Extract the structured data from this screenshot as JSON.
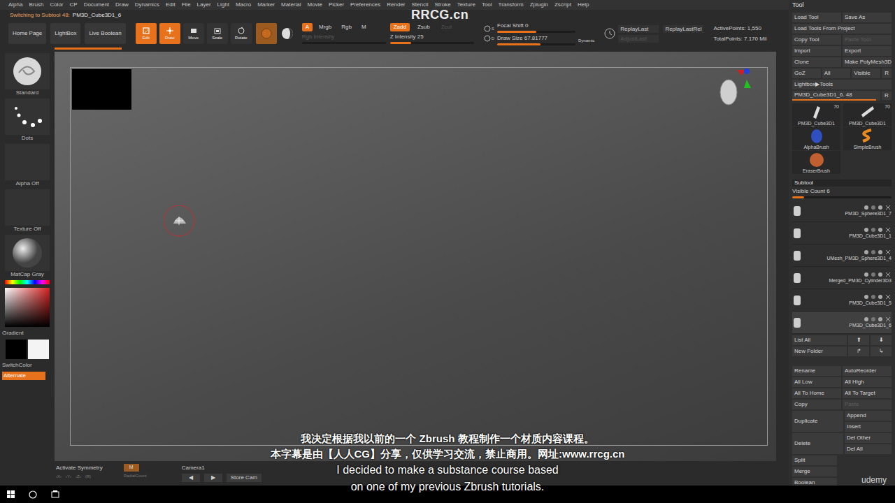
{
  "watermark": "RRCG.cn",
  "menu": [
    "Alpha",
    "Brush",
    "Color",
    "CP",
    "Document",
    "Draw",
    "Dynamics",
    "Edit",
    "File",
    "Layer",
    "Light",
    "Macro",
    "Marker",
    "Material",
    "Movie",
    "Picker",
    "Preferences",
    "Render",
    "Stencil",
    "Stroke",
    "Texture",
    "Tool",
    "Transform",
    "Zplugin",
    "Zscript",
    "Help"
  ],
  "status": {
    "label": "Switching to Subtool 48:",
    "value": "PM3D_Cube3D1_6"
  },
  "toolbar": {
    "nav": [
      "Home Page",
      "LightBox",
      "Live Boolean"
    ],
    "modes": [
      {
        "label": "Edit",
        "selected": true
      },
      {
        "label": "Draw",
        "selected": true
      },
      {
        "label": "Move",
        "selected": false
      },
      {
        "label": "Scale",
        "selected": false
      },
      {
        "label": "Rotate",
        "selected": false
      }
    ],
    "channels": [
      {
        "label": "A",
        "selected": true
      },
      {
        "label": "Mrgb",
        "selected": false
      },
      {
        "label": "Rgb",
        "selected": false
      },
      {
        "label": "M",
        "selected": false
      }
    ],
    "zmodes": [
      {
        "label": "Zadd",
        "selected": true,
        "disabled": false
      },
      {
        "label": "Zsub",
        "selected": false,
        "disabled": false
      },
      {
        "label": "Zcut",
        "selected": false,
        "disabled": true
      }
    ],
    "intensity": [
      {
        "label": "Rgb Intensity",
        "disabled": true,
        "level": 0.0
      },
      {
        "label": "Z Intensity 25",
        "disabled": false,
        "level": 0.25
      }
    ],
    "shortcuts": [
      "S",
      "D"
    ],
    "draw": [
      {
        "label": "Focal Shift 0",
        "level": 0.5
      },
      {
        "label": "Draw Size 67.81777",
        "level": 0.55
      }
    ],
    "dynamic": "Dynamic",
    "replay": [
      {
        "label": "ReplayLast",
        "disabled": false
      },
      {
        "label": "ReplayLastRel",
        "disabled": false
      },
      {
        "label": "AdjustLast",
        "disabled": true
      }
    ],
    "points": [
      "ActivePoints: 1,550",
      "TotalPoints: 7.170 Mil"
    ]
  },
  "shelf": {
    "items": [
      {
        "label": "Standard",
        "kind": "brush"
      },
      {
        "label": "Dots",
        "kind": "stroke"
      },
      {
        "label": "Alpha Off",
        "kind": "empty"
      },
      {
        "label": "Texture Off",
        "kind": "empty"
      },
      {
        "label": "MatCap Gray",
        "kind": "material"
      }
    ],
    "gradient": "Gradient",
    "switch": "SwitchColor",
    "alternate": "Alternate"
  },
  "bottom": {
    "symmetry": "Activate Symmetry",
    "axes": [
      "›X‹",
      "›Y‹",
      "›Z‹",
      "(R)"
    ],
    "m": "M",
    "radial": "RadialCount",
    "camera": "Camera1",
    "camera_nav": [
      "◀",
      "▶"
    ],
    "store": "Store Cam"
  },
  "tool": {
    "title": "Tool",
    "rows": [
      [
        {
          "label": "Load Tool",
          "disabled": false
        },
        {
          "label": "Save As",
          "disabled": false
        }
      ],
      [
        {
          "label": "Load Tools From Project",
          "disabled": false
        }
      ],
      [
        {
          "label": "Copy Tool",
          "disabled": false
        },
        {
          "label": "Paste Tool",
          "disabled": true
        }
      ],
      [
        {
          "label": "Import",
          "disabled": false
        },
        {
          "label": "Export",
          "disabled": false
        }
      ],
      [
        {
          "label": "Clone",
          "disabled": false
        },
        {
          "label": "Make PolyMesh3D",
          "disabled": false
        }
      ],
      [
        {
          "label": "GoZ",
          "disabled": false
        },
        {
          "label": "All",
          "disabled": false
        },
        {
          "label": "Visible",
          "disabled": false
        },
        {
          "label": "R",
          "disabled": false
        }
      ],
      [
        {
          "label": "Lightbox▶Tools",
          "disabled": false
        }
      ]
    ],
    "current": {
      "label": "PM3D_Cube3D1_6. 48",
      "level": 0.95,
      "r": "R"
    },
    "thumbs": [
      {
        "label": "PM3D_Cube3D1",
        "count": "70"
      },
      {
        "label": "PM3D_Cube3D1",
        "count": "70"
      },
      {
        "label": "AlphaBrush",
        "count": ""
      },
      {
        "label": "SimpleBrush",
        "count": ""
      },
      {
        "label": "EraserBrush",
        "count": ""
      }
    ]
  },
  "subtool": {
    "title": "Subtool",
    "visible_count": {
      "label": "Visible Count 6",
      "level": 0.12
    },
    "items": [
      {
        "label": "PM3D_Sphere3D1_7",
        "selected": false
      },
      {
        "label": "PM3D_Cube3D1_1",
        "selected": false
      },
      {
        "label": "UMesh_PM3D_Sphere3D1_4",
        "selected": false
      },
      {
        "label": "Merged_PM3D_Cylinder3D3",
        "selected": false
      },
      {
        "label": "PM3D_Cube3D1_5",
        "selected": false
      },
      {
        "label": "PM3D_Cube3D1_6",
        "selected": true
      }
    ],
    "list_rows": [
      {
        "label": "List All",
        "arrows": [
          "⬆",
          "⬇"
        ]
      },
      {
        "label": "New Folder",
        "arrows": [
          "↱",
          "↳"
        ]
      }
    ],
    "actions": [
      {
        "kind": "pair",
        "items": [
          {
            "label": "Rename",
            "disabled": false
          },
          {
            "label": "AutoReorder",
            "disabled": false
          }
        ]
      },
      {
        "kind": "pair",
        "items": [
          {
            "label": "All Low",
            "disabled": false
          },
          {
            "label": "All High",
            "disabled": false
          }
        ]
      },
      {
        "kind": "pair",
        "items": [
          {
            "label": "All To Home",
            "disabled": false
          },
          {
            "label": "All To Target",
            "disabled": false
          }
        ]
      },
      {
        "kind": "pair",
        "items": [
          {
            "label": "Copy",
            "disabled": false
          },
          {
            "label": "Paste",
            "disabled": true
          }
        ]
      },
      {
        "kind": "stack",
        "items": [
          {
            "label": "Duplicate",
            "disabled": false
          },
          {
            "label": "Append",
            "disabled": false
          },
          {
            "label": "Insert",
            "disabled": false
          }
        ]
      },
      {
        "kind": "stack",
        "items": [
          {
            "label": "Delete",
            "disabled": false
          },
          {
            "label": "Del Other",
            "disabled": false
          },
          {
            "label": "Del All",
            "disabled": false
          }
        ]
      },
      {
        "kind": "single",
        "items": [
          {
            "label": "Split",
            "disabled": false
          }
        ]
      },
      {
        "kind": "single",
        "items": [
          {
            "label": "Merge",
            "disabled": false
          }
        ]
      },
      {
        "kind": "single",
        "items": [
          {
            "label": "Boolean",
            "disabled": false
          }
        ]
      }
    ]
  },
  "subtitles": [
    "我决定根据我以前的一个 Zbrush 教程制作一个材质内容课程。",
    "本字幕是由【人人CG】分享，仅供学习交流，禁止商用。网址:www.rrcg.cn",
    "I decided to make a substance course based",
    "on one of my previous Zbrush tutorials."
  ],
  "brand": "udemy"
}
